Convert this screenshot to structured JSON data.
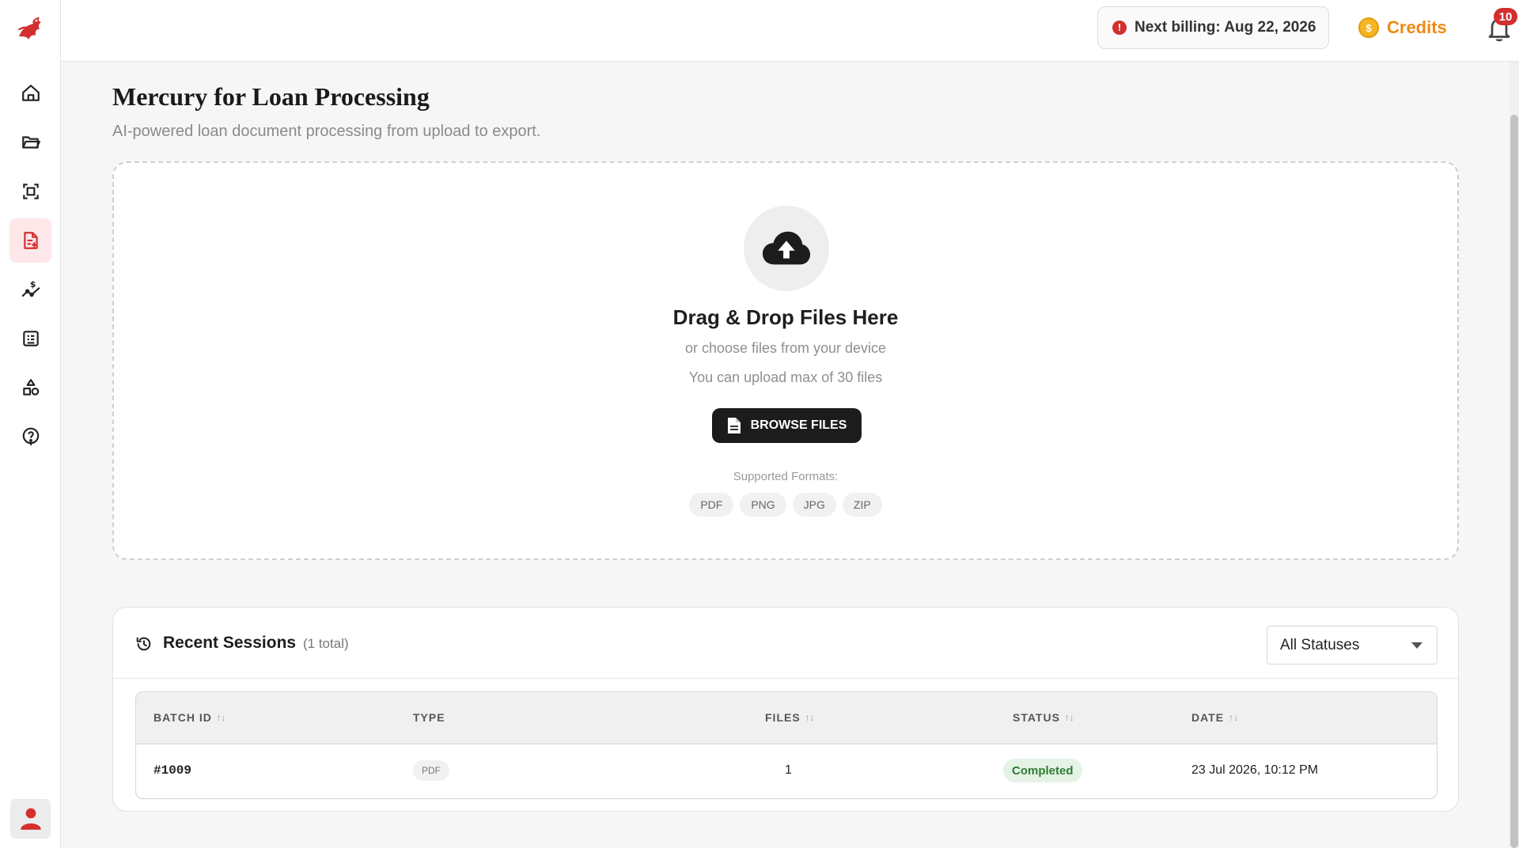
{
  "header": {
    "billing_text": "Next billing: Aug 22, 2026",
    "billing_icon": "info-alert-icon",
    "credits_label": "Credits",
    "credits_icon": "coin-icon",
    "coin_symbol": "$",
    "notification_count": "10",
    "accent_color": "#ef8a14",
    "alert_color": "#d32f2f"
  },
  "sidebar": {
    "logo": "dragon-logo",
    "items": [
      {
        "icon": "home-icon",
        "active": false
      },
      {
        "icon": "folder-icon",
        "active": false
      },
      {
        "icon": "scan-icon",
        "active": false
      },
      {
        "icon": "document-edit-icon",
        "active": true
      },
      {
        "icon": "dollar-chart-icon",
        "active": false
      },
      {
        "icon": "checklist-icon",
        "active": false
      },
      {
        "icon": "shapes-icon",
        "active": false
      },
      {
        "icon": "help-icon",
        "active": false
      }
    ],
    "active_color": "#d32f2f"
  },
  "page": {
    "title": "Mercury for Loan Processing",
    "subtitle": "AI-powered loan document processing from upload to export."
  },
  "upload": {
    "title": "Drag & Drop Files Here",
    "subtitle": "or choose files from your device",
    "limit_text": "You can upload max of 30 files",
    "browse_label": "BROWSE FILES",
    "formats_label": "Supported Formats:",
    "formats": [
      "PDF",
      "PNG",
      "JPG",
      "ZIP"
    ]
  },
  "sessions": {
    "title": "Recent Sessions",
    "count_text": "(1 total)",
    "status_filter": "All Statuses",
    "columns": {
      "batch_id": "BATCH ID",
      "type": "TYPE",
      "files": "FILES",
      "status": "STATUS",
      "date": "DATE"
    },
    "sort_glyph": "↑↓",
    "rows": [
      {
        "batch_id": "#1009",
        "type": "PDF",
        "files": "1",
        "status": "Completed",
        "date": "23 Jul 2026, 10:12 PM"
      }
    ],
    "status_color": "#2e7d32"
  }
}
